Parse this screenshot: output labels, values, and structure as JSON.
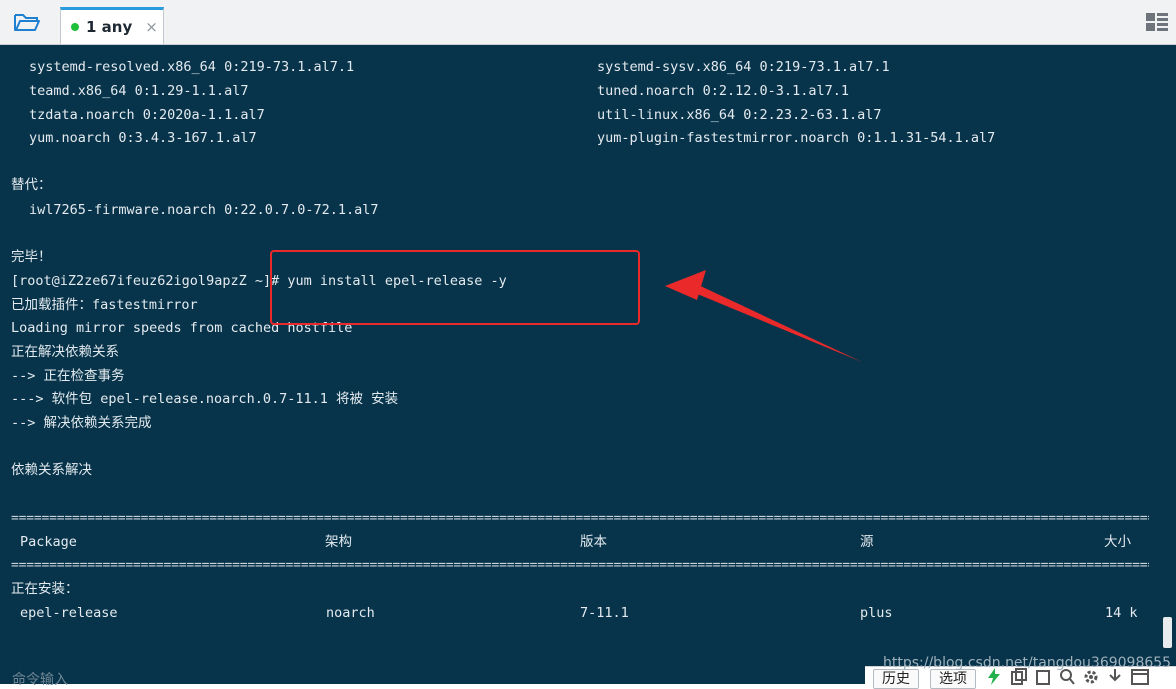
{
  "tab": {
    "label": "1 any",
    "close": "×",
    "status_color": "#1fbf3a"
  },
  "terminal": {
    "lines": {
      "l1": {
        "left": "systemd-resolved.x86_64 0:219-73.1.al7.1",
        "right": "systemd-sysv.x86_64 0:219-73.1.al7.1"
      },
      "l2": {
        "left": "teamd.x86_64 0:1.29-1.1.al7",
        "right": "tuned.noarch 0:2.12.0-3.1.al7.1"
      },
      "l3": {
        "left": "tzdata.noarch 0:2020a-1.1.al7",
        "right": "util-linux.x86_64 0:2.23.2-63.1.al7"
      },
      "l4": {
        "left": "yum.noarch 0:3.4.3-167.1.al7",
        "right": "yum-plugin-fastestmirror.noarch 0:1.1.31-54.1.al7"
      },
      "replaced_header": "替代：",
      "replaced_item": "iwl7265-firmware.noarch 0:22.0.7.0-72.1.al7",
      "done": "完毕！",
      "prompt": "[root@iZ2ze67ifeuz62igol9apzZ ~]# yum install epel-release -y",
      "plugin": "已加载插件：fastestmirror",
      "mirror": "Loading mirror speeds from cached hostfile",
      "resolving": "正在解决依赖关系",
      "checking": "--> 正在检查事务",
      "package_line": "---> 软件包 epel-release.noarch.0.7-11.1 将被 安装",
      "resolve_done": "--> 解决依赖关系完成",
      "deps_resolved": "依赖关系解决",
      "separator": "================================================================================================================================================================",
      "table_header": {
        "package": "Package",
        "arch": "架构",
        "version": "版本",
        "repo": "源",
        "size": "大小"
      },
      "installing": "正在安装：",
      "row": {
        "package": "epel-release",
        "arch": "noarch",
        "version": "7-11.1",
        "repo": "plus",
        "size": "14 k"
      }
    }
  },
  "command_input": {
    "placeholder": "命令输入"
  },
  "watermark": "https://blog.csdn.net/tangdou369098655",
  "bottom_bar": {
    "history": "历史",
    "options": "选项"
  },
  "colors": {
    "terminal_bg": "#07344a",
    "terminal_fg": "#e4eaef",
    "annotation": "#ea2a2a",
    "tab_accent": "#2b9be0"
  }
}
